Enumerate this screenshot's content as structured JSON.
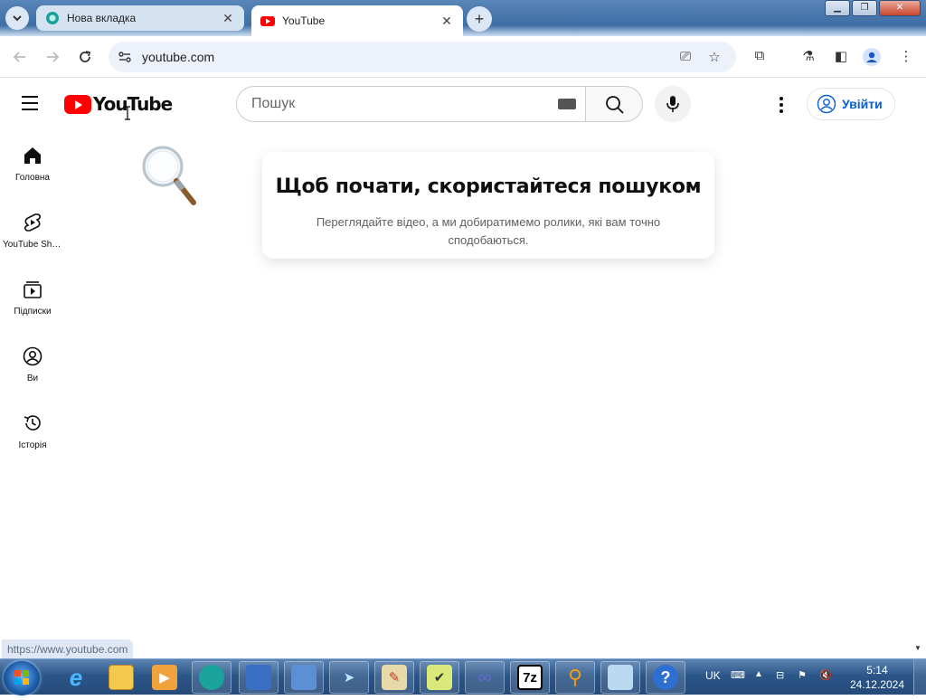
{
  "browser": {
    "tabs": [
      {
        "title": "Нова вкладка",
        "active": false
      },
      {
        "title": "YouTube",
        "active": true
      }
    ],
    "url": "youtube.com",
    "status_url": "https://www.youtube.com"
  },
  "youtube": {
    "logo_text": "YouTube",
    "search_placeholder": "Пошук",
    "signin_label": "Увійти",
    "sidebar": [
      {
        "label": "Головна",
        "icon": "home-icon"
      },
      {
        "label": "YouTube Shorts",
        "icon": "shorts-icon"
      },
      {
        "label": "Підписки",
        "icon": "subscriptions-icon"
      },
      {
        "label": "Ви",
        "icon": "you-icon"
      },
      {
        "label": "Історія",
        "icon": "history-icon"
      }
    ],
    "empty_state": {
      "title": "Щоб почати, скористайтеся пошуком",
      "text": "Переглядайте відео, а ми добиратимемо ролики, які вам точно сподобаються."
    }
  },
  "taskbar": {
    "lang": "UK",
    "time": "5:14",
    "date": "24.12.2024",
    "apps": [
      "ie-icon",
      "explorer-icon",
      "media-player-icon",
      "browser-icon",
      "network-icon",
      "remote-icon",
      "telegram-icon",
      "paint-icon",
      "editor-icon",
      "infinity-icon",
      "7zip-icon",
      "search-tool-icon",
      "notes-icon",
      "help-icon"
    ],
    "app_labels": {
      "sevenzip": "7z",
      "help": "?"
    }
  },
  "colors": {
    "yt_red": "#ff0000",
    "signin_blue": "#065fd4",
    "taskbar": "#2c5688"
  }
}
